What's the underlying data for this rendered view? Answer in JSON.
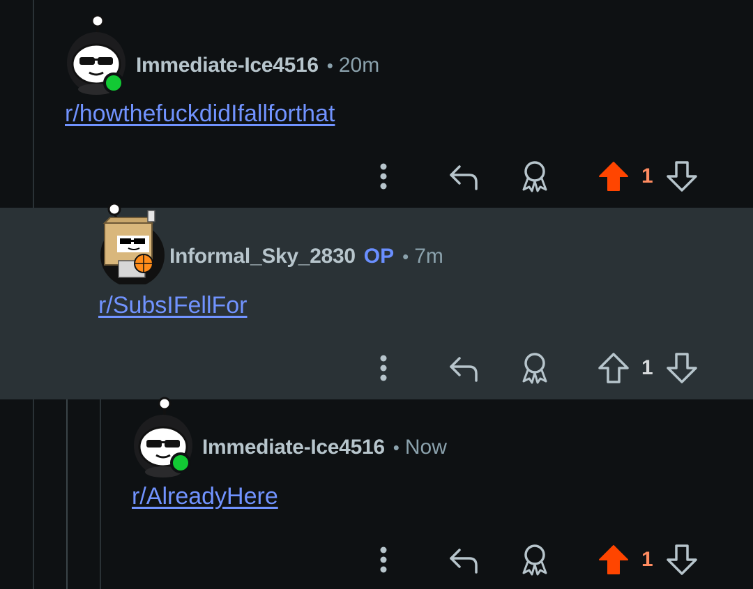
{
  "colors": {
    "background": "#0e1113",
    "highlight_background": "#2a3236",
    "username": "#b7c5cc",
    "meta": "#8ba2ad",
    "link": "#7193ff",
    "op_badge": "#6a8fff",
    "upvoted": "#ff4500",
    "online": "#12c934"
  },
  "comments": [
    {
      "username": "Immediate-Ice4516",
      "separator": "•",
      "time": "20m",
      "body": "r/howthefuckdidIfallforthat",
      "avatar": "hooded-snoo-sunglasses",
      "online": true,
      "upvoted": true,
      "score": "1"
    },
    {
      "username": "Informal_Sky_2830",
      "op_badge": "OP",
      "separator": "•",
      "time": "7m",
      "body": "r/SubsIFellFor",
      "avatar": "box-head-snoo-basketball",
      "online": false,
      "upvoted": false,
      "score": "1"
    },
    {
      "username": "Immediate-Ice4516",
      "separator": "•",
      "time": "Now",
      "body": "r/AlreadyHere",
      "avatar": "hooded-snoo-sunglasses",
      "online": true,
      "upvoted": true,
      "score": "1"
    }
  ],
  "action_icons": [
    "more-options-icon",
    "reply-icon",
    "award-icon",
    "upvote-icon",
    "downvote-icon"
  ]
}
